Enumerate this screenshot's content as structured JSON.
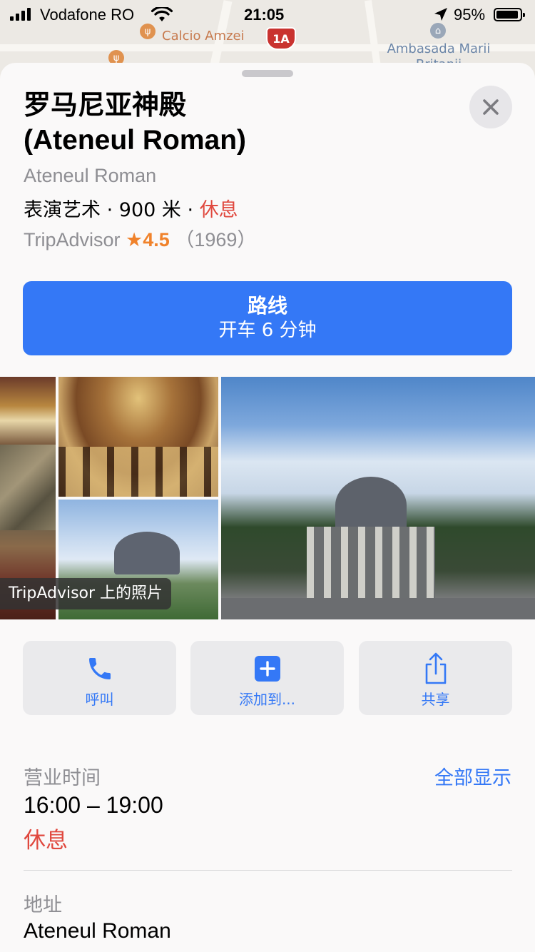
{
  "status_bar": {
    "carrier": "Vodafone RO",
    "time": "21:05",
    "battery_percent": "95%",
    "battery_level": 0.95,
    "icons": [
      "signal-icon",
      "wifi-icon",
      "location-arrow-icon",
      "battery-icon"
    ]
  },
  "map": {
    "pois": [
      {
        "label": "Calcio Amzei",
        "icon": "restaurant-icon"
      },
      {
        "label": "1A",
        "icon": "route-shield-icon"
      },
      {
        "label": "Ambasada Marii Britanii",
        "icon": "embassy-icon"
      }
    ]
  },
  "place": {
    "title_line1": "罗马尼亚神殿",
    "title_line2": "(Ateneul Roman)",
    "subtitle": "Ateneul Roman",
    "category": "表演艺术",
    "distance": "900 米",
    "separator": "·",
    "status": "休息",
    "rating_source": "TripAdvisor",
    "rating_star": "★",
    "rating": "4.5",
    "review_count": "（1969）"
  },
  "directions": {
    "label": "路线",
    "travel_time": "开车 6 分钟"
  },
  "photos": {
    "label": "TripAdvisor 上的照片"
  },
  "actions": [
    {
      "label": "呼叫",
      "icon": "phone-icon"
    },
    {
      "label": "添加到...",
      "icon": "add-icon"
    },
    {
      "label": "共享",
      "icon": "share-icon"
    }
  ],
  "hours": {
    "label": "营业时间",
    "show_all": "全部显示",
    "range": "16:00 – 19:00",
    "status": "休息"
  },
  "address": {
    "label": "地址",
    "value": "Ateneul Roman"
  },
  "colors": {
    "accent": "#3478f6",
    "closed": "#e0483e",
    "rating": "#f0822b"
  }
}
